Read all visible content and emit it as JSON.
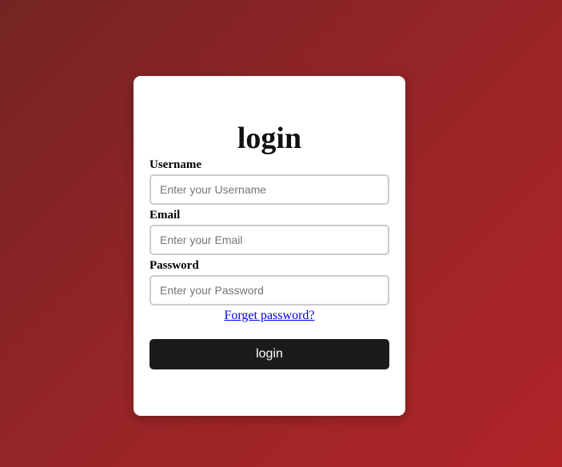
{
  "title": "login",
  "fields": [
    {
      "label": "Username",
      "placeholder": "Enter your Username"
    },
    {
      "label": "Email",
      "placeholder": "Enter your Email"
    },
    {
      "label": "Password",
      "placeholder": "Enter your Password"
    }
  ],
  "forgot_link": "Forget password?",
  "submit_label": "login"
}
